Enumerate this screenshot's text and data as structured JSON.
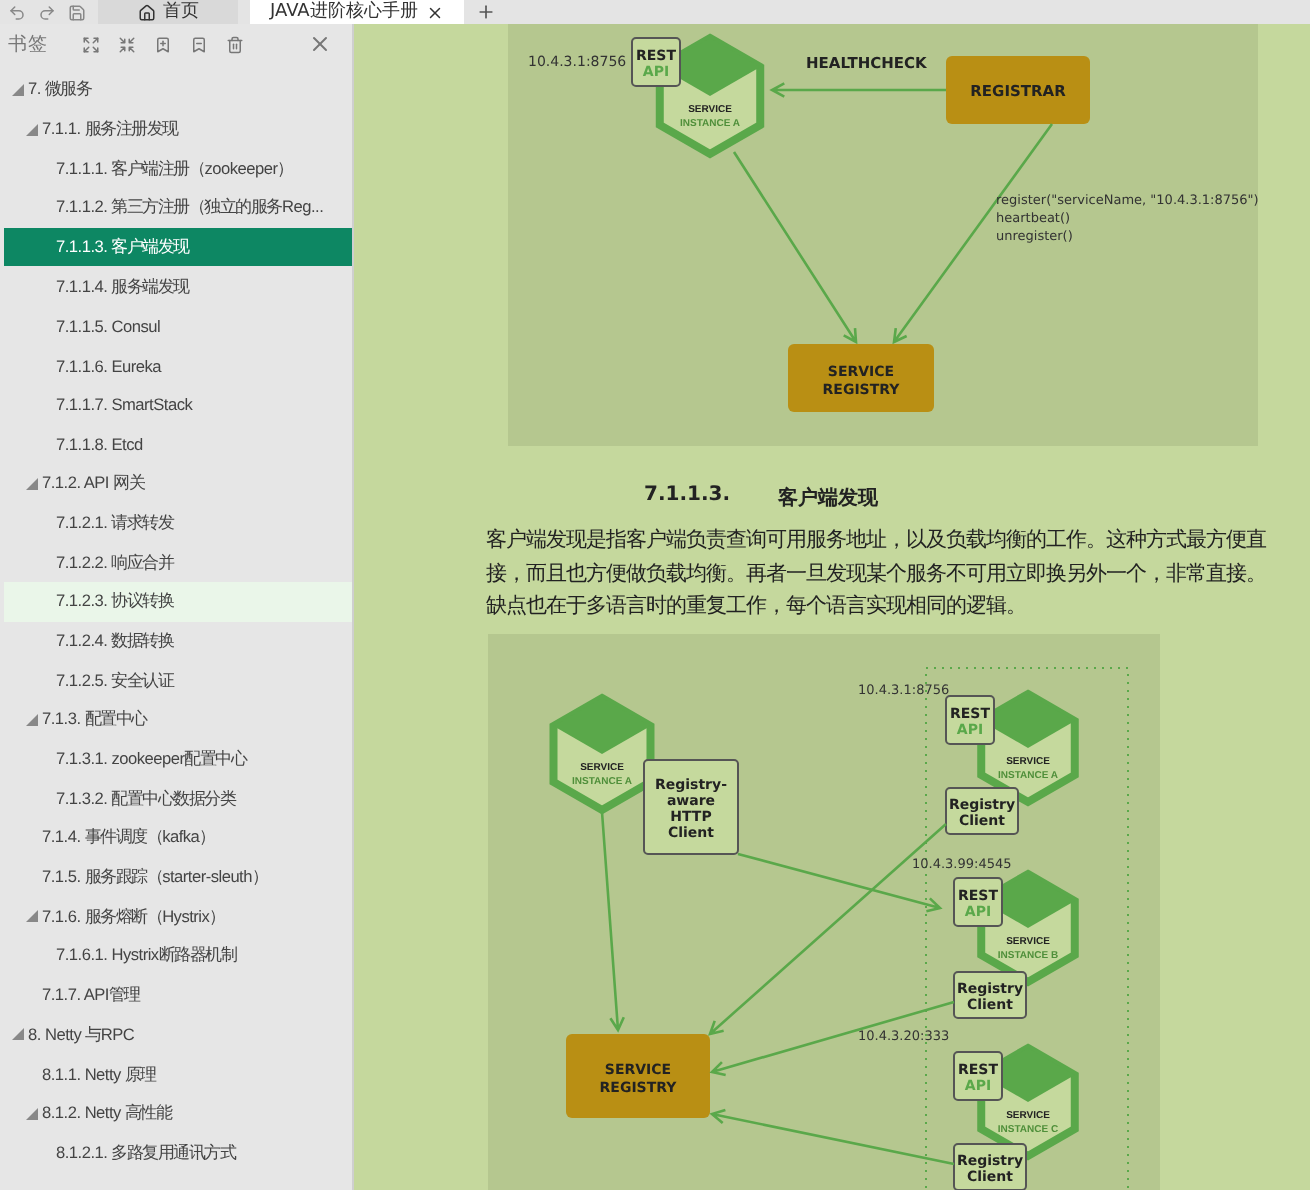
{
  "toolbar": {
    "tabs": [
      {
        "label": "首页",
        "selected": false,
        "kind": "home"
      },
      {
        "label": "JAVA进阶核心手册",
        "selected": true,
        "kind": "doc"
      }
    ]
  },
  "sidebar": {
    "title": "书签",
    "items": [
      {
        "label": "7.  微服务",
        "expanded": true,
        "selected": false,
        "hovered": false,
        "children": [
          {
            "label": "7.1.1. 服务注册发现",
            "expanded": true,
            "selected": false,
            "hovered": false,
            "children": [
              {
                "label": "7.1.1.1. 客户端注册（zookeeper）",
                "selected": false,
                "hovered": false
              },
              {
                "label": "7.1.1.2. 第三方注册（独立的服务Reg...",
                "selected": false,
                "hovered": false
              },
              {
                "label": "7.1.1.3. 客户端发现",
                "selected": true,
                "hovered": false
              },
              {
                "label": "7.1.1.4. 服务端发现",
                "selected": false,
                "hovered": false
              },
              {
                "label": "7.1.1.5. Consul",
                "selected": false,
                "hovered": false
              },
              {
                "label": "7.1.1.6. Eureka",
                "selected": false,
                "hovered": false
              },
              {
                "label": "7.1.1.7. SmartStack",
                "selected": false,
                "hovered": false
              },
              {
                "label": "7.1.1.8. Etcd",
                "selected": false,
                "hovered": false
              }
            ]
          },
          {
            "label": "7.1.2. API 网关",
            "expanded": true,
            "selected": false,
            "hovered": false,
            "children": [
              {
                "label": "7.1.2.1. 请求转发",
                "selected": false,
                "hovered": false
              },
              {
                "label": "7.1.2.2. 响应合并",
                "selected": false,
                "hovered": false
              },
              {
                "label": "7.1.2.3. 协议转换",
                "selected": false,
                "hovered": true
              },
              {
                "label": "7.1.2.4. 数据转换",
                "selected": false,
                "hovered": false
              },
              {
                "label": "7.1.2.5. 安全认证",
                "selected": false,
                "hovered": false
              }
            ]
          },
          {
            "label": "7.1.3. 配置中心",
            "expanded": true,
            "selected": false,
            "hovered": false,
            "children": [
              {
                "label": "7.1.3.1. zookeeper配置中心",
                "selected": false,
                "hovered": false
              },
              {
                "label": "7.1.3.2. 配置中心数据分类",
                "selected": false,
                "hovered": false
              }
            ]
          },
          {
            "label": "7.1.4. 事件调度（kafka）",
            "selected": false,
            "hovered": false
          },
          {
            "label": "7.1.5. 服务跟踪（starter-sleuth）",
            "selected": false,
            "hovered": false
          },
          {
            "label": "7.1.6. 服务熔断（Hystrix）",
            "expanded": true,
            "selected": false,
            "hovered": false,
            "children": [
              {
                "label": "7.1.6.1. Hystrix断路器机制",
                "selected": false,
                "hovered": false
              }
            ]
          },
          {
            "label": "7.1.7. API管理",
            "selected": false,
            "hovered": false
          }
        ]
      },
      {
        "label": "8. Netty 与RPC",
        "expanded": true,
        "selected": false,
        "hovered": false,
        "children": [
          {
            "label": "8.1.1. Netty 原理",
            "selected": false,
            "hovered": false
          },
          {
            "label": "8.1.2. Netty 高性能",
            "expanded": true,
            "selected": false,
            "hovered": false,
            "children": [
              {
                "label": "8.1.2.1. 多路复用通讯方式",
                "selected": false,
                "hovered": false
              }
            ]
          }
        ]
      }
    ]
  },
  "document": {
    "figure_1": {
      "address": "10.4.3.1:8756",
      "rest_api": [
        "REST",
        "API"
      ],
      "service": [
        "SERVICE",
        "INSTANCE A"
      ],
      "healthcheck": "HEALTHCHECK",
      "registrar": "REGISTRAR",
      "calls": [
        "register(\"serviceName, \"10.4.3.1:8756\")",
        "heartbeat()",
        "unregister()"
      ],
      "registry": [
        "SERVICE",
        "REGISTRY"
      ]
    },
    "heading_number": "7.1.1.3.",
    "heading": "客户端发现",
    "paragraph": "客户端发现是指客户端负责查询可用服务地址，以及负载均衡的工作。这种方式最方便直接，而且也方便做负载均衡。再者一旦发现某个服务不可用立即换另外一个，非常直接。缺点也在于多语言时的重复工作，每个语言实现相同的逻辑。",
    "figure_2": {
      "client_service": [
        "SERVICE",
        "INSTANCE A"
      ],
      "http_client": [
        "Registry-",
        "aware",
        "HTTP",
        "Client"
      ],
      "registry": [
        "SERVICE",
        "REGISTRY"
      ],
      "instances": [
        {
          "address": "10.4.3.1:8756",
          "rest_api": [
            "REST",
            "API"
          ],
          "service": [
            "SERVICE",
            "INSTANCE A"
          ],
          "client": [
            "Registry",
            "Client"
          ]
        },
        {
          "address": "10.4.3.99:4545",
          "rest_api": [
            "REST",
            "API"
          ],
          "service": [
            "SERVICE",
            "INSTANCE B"
          ],
          "client": [
            "Registry",
            "Client"
          ]
        },
        {
          "address": "10.4.3.20:333",
          "rest_api": [
            "REST",
            "API"
          ],
          "service": [
            "SERVICE",
            "INSTANCE C"
          ],
          "client": [
            "Registry",
            "Client"
          ]
        }
      ]
    }
  }
}
